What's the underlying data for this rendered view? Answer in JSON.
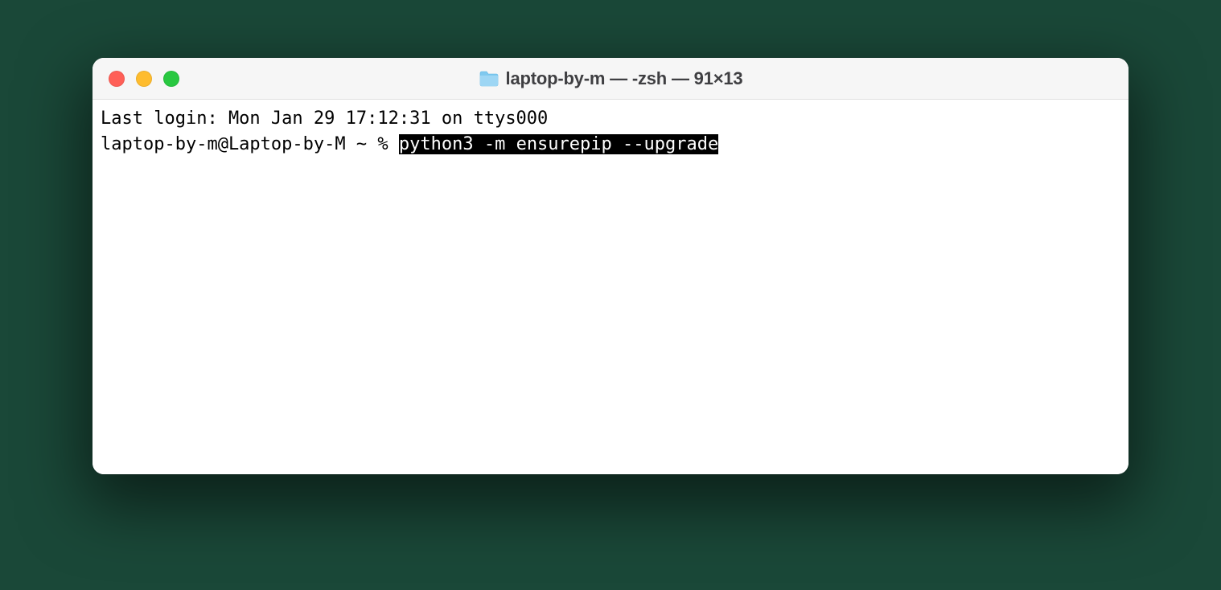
{
  "window": {
    "title": "laptop-by-m — -zsh — 91×13"
  },
  "terminal": {
    "last_login": "Last login: Mon Jan 29 17:12:31 on ttys000",
    "prompt": "laptop-by-m@Laptop-by-M ~ % ",
    "command_selected": "python3 -m ensurepip --upgrade"
  }
}
